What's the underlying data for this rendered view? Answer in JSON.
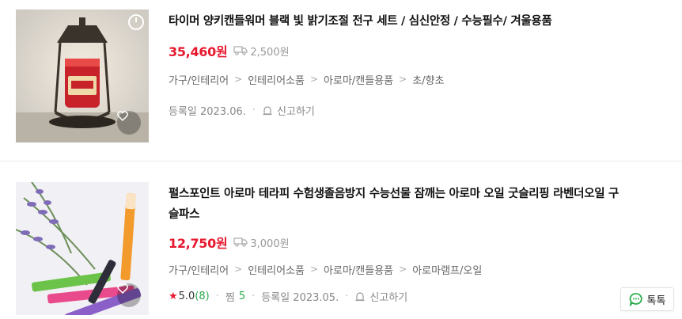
{
  "products": [
    {
      "title": "타이머 양키캔들워머 블랙 빛 밝기조절 전구 세트 / 심신안정 / 수능필수/ 겨울용품",
      "price": "35,460원",
      "shipping": "2,500원",
      "categories": [
        "가구/인테리어",
        "인테리어소품",
        "아로마/캔들용품",
        "초/향초"
      ],
      "registered": "등록일 2023.06.",
      "report_label": "신고하기",
      "icon": "heart-icon"
    },
    {
      "title_line1": "펄스포인트 아로마 테라피 수험생졸음방지 수능선물 잠깨는 아로마 오일 굿슬리핑 라벤더오일 구",
      "title_line2": "슬파스",
      "price": "12,750원",
      "shipping": "3,000원",
      "categories": [
        "가구/인테리어",
        "인테리어소품",
        "아로마/캔들용품",
        "아로마램프/오일"
      ],
      "rating": "5.0",
      "rating_count": "(8)",
      "zzim_label": "찜",
      "zzim_count": "5",
      "registered": "등록일 2023.05.",
      "report_label": "신고하기"
    }
  ],
  "talk_button": {
    "label": "톡톡"
  },
  "colors": {
    "price": "#e6182e",
    "accent_green": "#2bab4c",
    "text_gray": "#888888"
  }
}
